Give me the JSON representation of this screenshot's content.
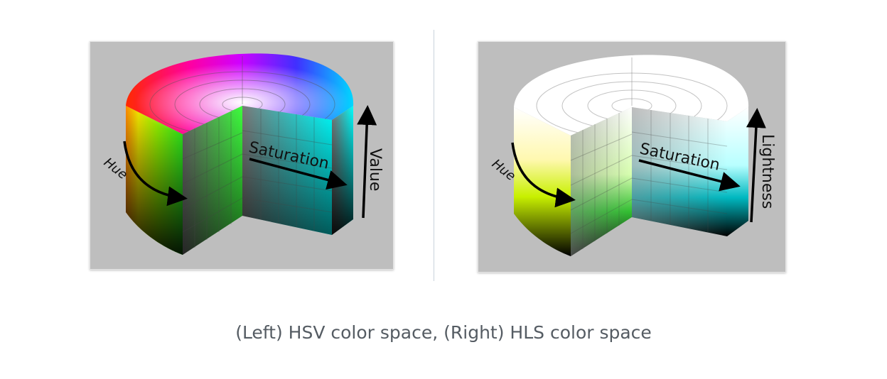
{
  "left": {
    "hue_label": "Hue",
    "saturation_label": "Saturation",
    "axis_label": "Value"
  },
  "right": {
    "hue_label": "Hue",
    "saturation_label": "Saturation",
    "axis_label": "Lightness"
  },
  "caption": "(Left) HSV color space, (Right) HLS color space"
}
